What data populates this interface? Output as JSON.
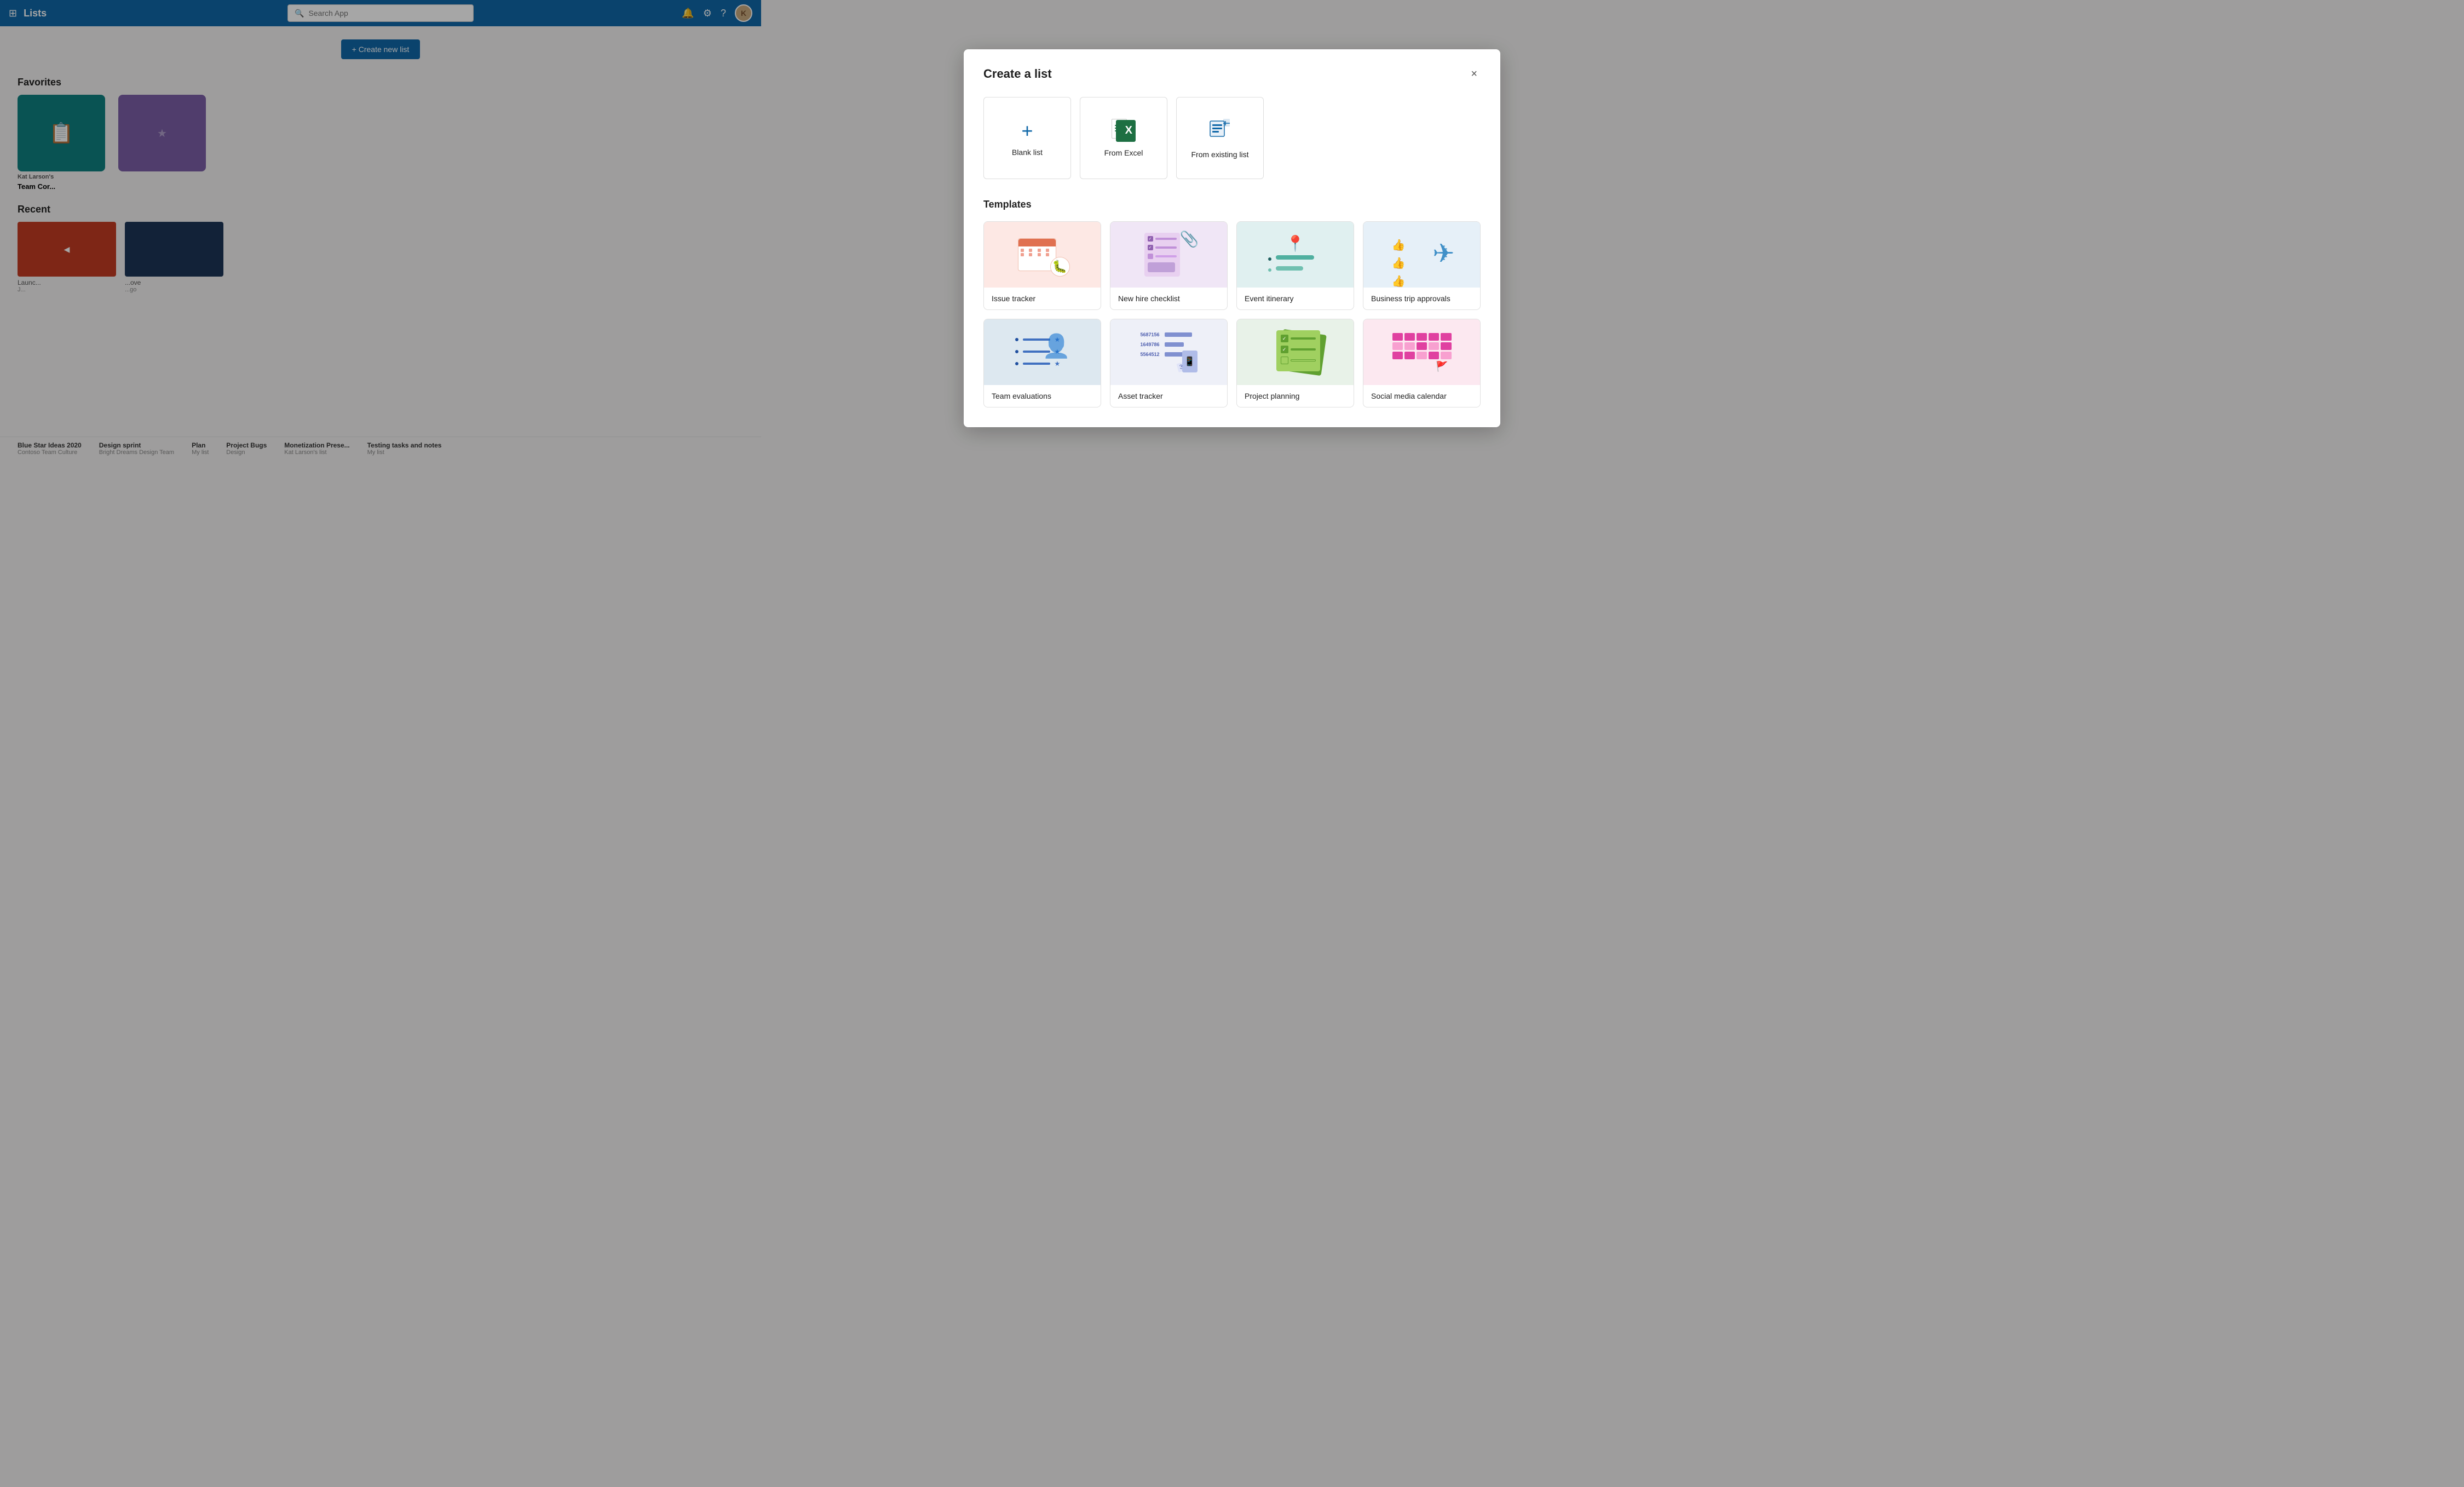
{
  "app": {
    "title": "Lists"
  },
  "nav": {
    "search_placeholder": "Search App",
    "create_button": "+ Create new list"
  },
  "favorites": {
    "section_title": "Favorites",
    "items": [
      {
        "name": "Team Cor...",
        "owner": "Kat Larson's",
        "color": "teal"
      }
    ]
  },
  "recent": {
    "section_title": "Recent",
    "items": [
      {
        "name": "Launc...",
        "meta": "J...",
        "color": "red"
      },
      {
        "name": "...ove",
        "meta": "...go",
        "color": "dark"
      }
    ]
  },
  "bottom_bar": {
    "items": [
      {
        "name": "Blue Star Ideas 2020",
        "sub": "Contoso Team Culture"
      },
      {
        "name": "Design sprint",
        "sub": "Bright Dreams Design Team"
      },
      {
        "name": "Plan",
        "sub": "My list"
      },
      {
        "name": "Project Bugs",
        "sub": "Design"
      },
      {
        "name": "Monetization Prese...",
        "sub": "Kat Larson's list"
      },
      {
        "name": "Testing tasks and notes",
        "sub": "My list"
      }
    ]
  },
  "modal": {
    "title": "Create a list",
    "close_label": "×",
    "create_options": [
      {
        "id": "blank",
        "label": "Blank list",
        "icon": "plus"
      },
      {
        "id": "excel",
        "label": "From Excel",
        "icon": "excel"
      },
      {
        "id": "existing",
        "label": "From existing list",
        "icon": "list"
      }
    ],
    "templates_title": "Templates",
    "templates": [
      {
        "id": "issue-tracker",
        "name": "Issue tracker",
        "thumb_type": "issue"
      },
      {
        "id": "new-hire-checklist",
        "name": "New hire checklist",
        "thumb_type": "newhire"
      },
      {
        "id": "event-itinerary",
        "name": "Event itinerary",
        "thumb_type": "event"
      },
      {
        "id": "business-trip",
        "name": "Business trip approvals",
        "thumb_type": "biztrip"
      },
      {
        "id": "team-evaluations",
        "name": "Team evaluations",
        "thumb_type": "teameval"
      },
      {
        "id": "asset-tracker",
        "name": "Asset tracker",
        "thumb_type": "asset"
      },
      {
        "id": "project-planning",
        "name": "Project planning",
        "thumb_type": "project"
      },
      {
        "id": "social-media",
        "name": "Social media calendar",
        "thumb_type": "social"
      }
    ]
  }
}
